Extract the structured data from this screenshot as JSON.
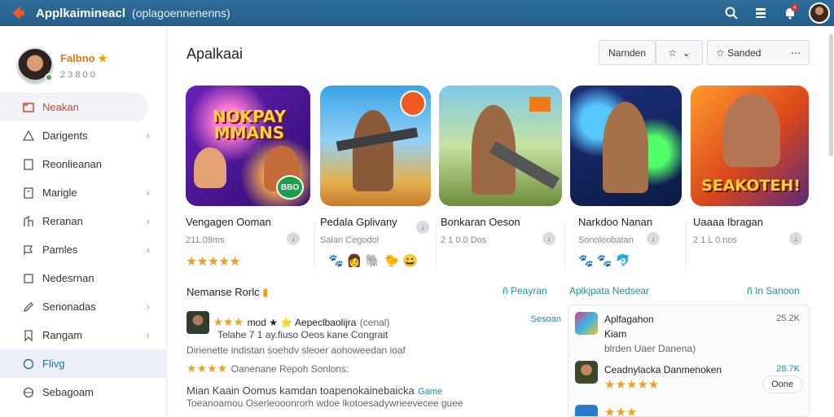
{
  "topbar": {
    "title": "Applkaimineacl",
    "subtitle": "(oplagoennenenns)",
    "notification_count": "4"
  },
  "profile": {
    "name": "Falbno",
    "meta": "2 3 8 0 0"
  },
  "sidebar": {
    "items": [
      {
        "label": "Neakan",
        "chevron": false,
        "active": true
      },
      {
        "label": "Darigents",
        "chevron": true
      },
      {
        "label": "Reonlieanan",
        "chevron": false
      },
      {
        "label": "Marigle",
        "chevron": true
      },
      {
        "label": "Reranan",
        "chevron": true
      },
      {
        "label": "Pamles",
        "chevron": true
      },
      {
        "label": "Nedesrnan",
        "chevron": false
      },
      {
        "label": "Senonadas",
        "chevron": true
      },
      {
        "label": "Rangam",
        "chevron": true
      },
      {
        "label": "Flivg",
        "chevron": false,
        "highlight": true
      },
      {
        "label": "Sebagoam",
        "chevron": false
      }
    ]
  },
  "main": {
    "title": "Apalkaai",
    "filter1": "Narnden",
    "filter3": "Sanded"
  },
  "cards": [
    {
      "title": "Vengagen Ooman",
      "meta": "211.09ms",
      "rating": "★★★★★",
      "art_text": "NOKPAY MMANS",
      "badge": "BBO"
    },
    {
      "title": "Pedala Gplivany",
      "meta": "Salan Cegodol",
      "emoji": "🐾 👩 🐘 🐤 😀"
    },
    {
      "title": "Bonkaran Oeson",
      "meta": "2 1 0.0 Dos"
    },
    {
      "title": "Narkdoo Nanan",
      "meta": "Sonoloobatan",
      "emoji": "🐾 🐾 🐬"
    },
    {
      "title": "Uaaaa Ibragan",
      "meta": "2 1 L 0.nos",
      "art_text": "SEAKOTEH!"
    }
  ],
  "section_left": {
    "title": "Nemanse Rorlc",
    "link": "ñ Peayran",
    "feed": [
      {
        "title": "mod ★ ⭐ Aepeclbaolijra",
        "extra": "(cenal)",
        "link": "Sesoan"
      },
      {
        "line1": "Telahe 7 1 ay.fiuso Oeos kane Congrait",
        "line2": "Dirienette indistan soehdv sleoer aohoweedan ioaf"
      },
      {
        "line1": "Oanenane Repoh Sonlons:"
      },
      {
        "line1": "Mian Kaain Oomus kamdan toapenokainebaicka",
        "link": "Game",
        "line2": "Toeanoamou Oserleooonrorh wdoe lkotoesadywrieevecee guee"
      }
    ]
  },
  "section_right": {
    "title": "Aplkjpata Nedsear",
    "link": "ñ In Sanoon",
    "rows": [
      {
        "text": "Aplfagahon",
        "sub": "Kiam",
        "size": "25.2K",
        "note": "blrden Uaer Danena)"
      },
      {
        "text": "Ceadnylacka Danmenoken",
        "size": "28.7K",
        "btn": "Oone"
      },
      {
        "text": "",
        "size": ""
      }
    ]
  }
}
